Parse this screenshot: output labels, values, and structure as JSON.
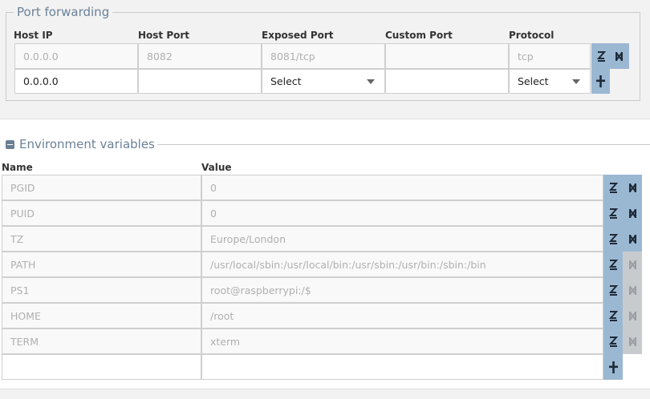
{
  "port_forwarding": {
    "title": "Port forwarding",
    "headers": {
      "host_ip": "Host IP",
      "host_port": "Host Port",
      "exposed_port": "Exposed Port",
      "custom_port": "Custom Port",
      "protocol": "Protocol"
    },
    "existing": {
      "host_ip": "0.0.0.0",
      "host_port": "8082",
      "exposed_port": "8081/tcp",
      "custom_port": "",
      "protocol": "tcp"
    },
    "new_row": {
      "host_ip": "0.0.0.0",
      "host_port": "",
      "exposed_port": "Select",
      "custom_port": "",
      "protocol": "Select"
    }
  },
  "env": {
    "title": "Environment variables",
    "headers": {
      "name": "Name",
      "value": "Value"
    },
    "rows": [
      {
        "name": "PGID",
        "value": "0",
        "removable": true
      },
      {
        "name": "PUID",
        "value": "0",
        "removable": true
      },
      {
        "name": "TZ",
        "value": "Europe/London",
        "removable": true
      },
      {
        "name": "PATH",
        "value": "/usr/local/sbin:/usr/local/bin:/usr/sbin:/usr/bin:/sbin:/bin",
        "removable": false
      },
      {
        "name": "PS1",
        "value": "root@raspberrypi:/$",
        "removable": false
      },
      {
        "name": "HOME",
        "value": "/root",
        "removable": false
      },
      {
        "name": "TERM",
        "value": "xterm",
        "removable": false
      }
    ],
    "new_row": {
      "name": "",
      "value": ""
    }
  },
  "icons": {
    "edit": "edit-icon",
    "remove": "remove-icon",
    "add": "add-icon",
    "collapse": "collapse-icon"
  },
  "colors": {
    "action_active": "#9bb8d3",
    "action_disabled": "#c8cbcd",
    "legend": "#6b8199"
  }
}
